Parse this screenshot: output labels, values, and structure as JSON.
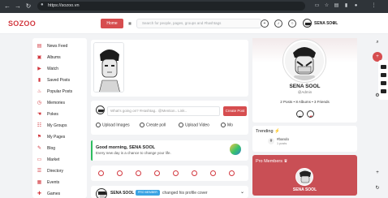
{
  "browser": {
    "url": "https://sozoo.vn",
    "back_icon": "arrow-left-icon",
    "forward_icon": "arrow-right-icon",
    "reload_icon": "reload-icon"
  },
  "header": {
    "logo": "SOZOO",
    "home_label": "Home",
    "search_placeholder": "Search for people, pages, groups and #hashtags",
    "user_name": "SENA SOOL"
  },
  "sidebar": {
    "items": [
      {
        "label": "News Feed",
        "icon": "newspaper-icon"
      },
      {
        "label": "Albums",
        "icon": "albums-icon"
      },
      {
        "label": "Watch",
        "icon": "play-icon"
      },
      {
        "label": "Saved Posts",
        "icon": "bookmark-icon"
      },
      {
        "label": "Popular Posts",
        "icon": "fire-icon"
      },
      {
        "label": "Memories",
        "icon": "clock-icon"
      },
      {
        "label": "Pokes",
        "icon": "hand-icon"
      },
      {
        "label": "My Groups",
        "icon": "group-icon"
      },
      {
        "label": "My Pages",
        "icon": "flag-icon"
      },
      {
        "label": "Blog",
        "icon": "blog-icon"
      },
      {
        "label": "Market",
        "icon": "cart-icon"
      },
      {
        "label": "Directory",
        "icon": "directory-icon"
      },
      {
        "label": "Events",
        "icon": "calendar-icon"
      },
      {
        "label": "Games",
        "icon": "gamepad-icon"
      }
    ]
  },
  "composer": {
    "placeholder": "What's going on? #Hashtag.. @Mention.. Link..",
    "create_label": "Create Post",
    "actions": [
      {
        "label": "Upload Images"
      },
      {
        "label": "Create poll"
      },
      {
        "label": "Upload Video"
      },
      {
        "label": "Mo"
      }
    ]
  },
  "greeting": {
    "title": "Good morning, SENA SOOL",
    "subtitle": "Every new day is a chance to change your life."
  },
  "feed": {
    "post_author": "SENA SOOL",
    "post_badge": "PRO MEMBER",
    "post_action": "changed his profile cover"
  },
  "profile": {
    "name": "SENA SOOL",
    "handle": "@Admin",
    "stats": "2 Posts • 8 Albums • 3 Friends"
  },
  "trending": {
    "heading": "Trending",
    "tag": "#bando",
    "count": "1 posts"
  },
  "pro_members": {
    "heading": "Pro Members",
    "name": "SENA SOOL"
  },
  "colors": {
    "accent": "#d64d4f",
    "chrome": "#2f3439",
    "greeting_bar": "#2ebd5f",
    "pro_card": "#c94f55"
  }
}
